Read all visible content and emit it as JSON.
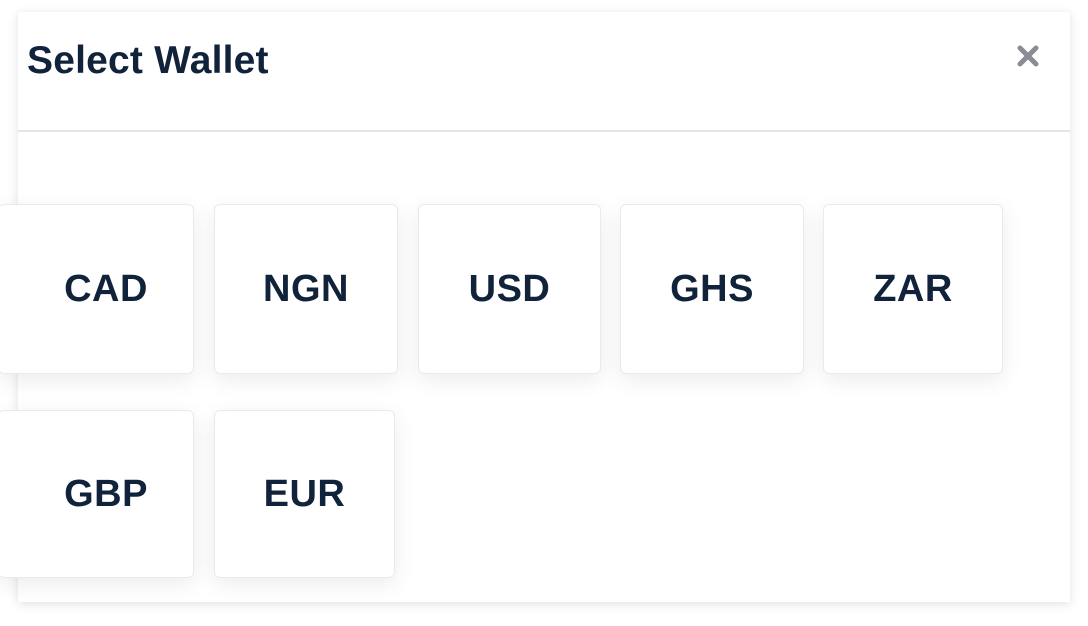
{
  "modal": {
    "title": "Select Wallet",
    "close_icon": "close-icon",
    "close_symbol": "✕"
  },
  "wallets": [
    {
      "code": "CAD"
    },
    {
      "code": "NGN"
    },
    {
      "code": "USD"
    },
    {
      "code": "GHS"
    },
    {
      "code": "ZAR"
    },
    {
      "code": "GBP"
    },
    {
      "code": "EUR"
    }
  ],
  "colors": {
    "text": "#11223b",
    "close": "#8a8d93",
    "border": "#e8eaee",
    "divider": "#e3e5ea"
  }
}
